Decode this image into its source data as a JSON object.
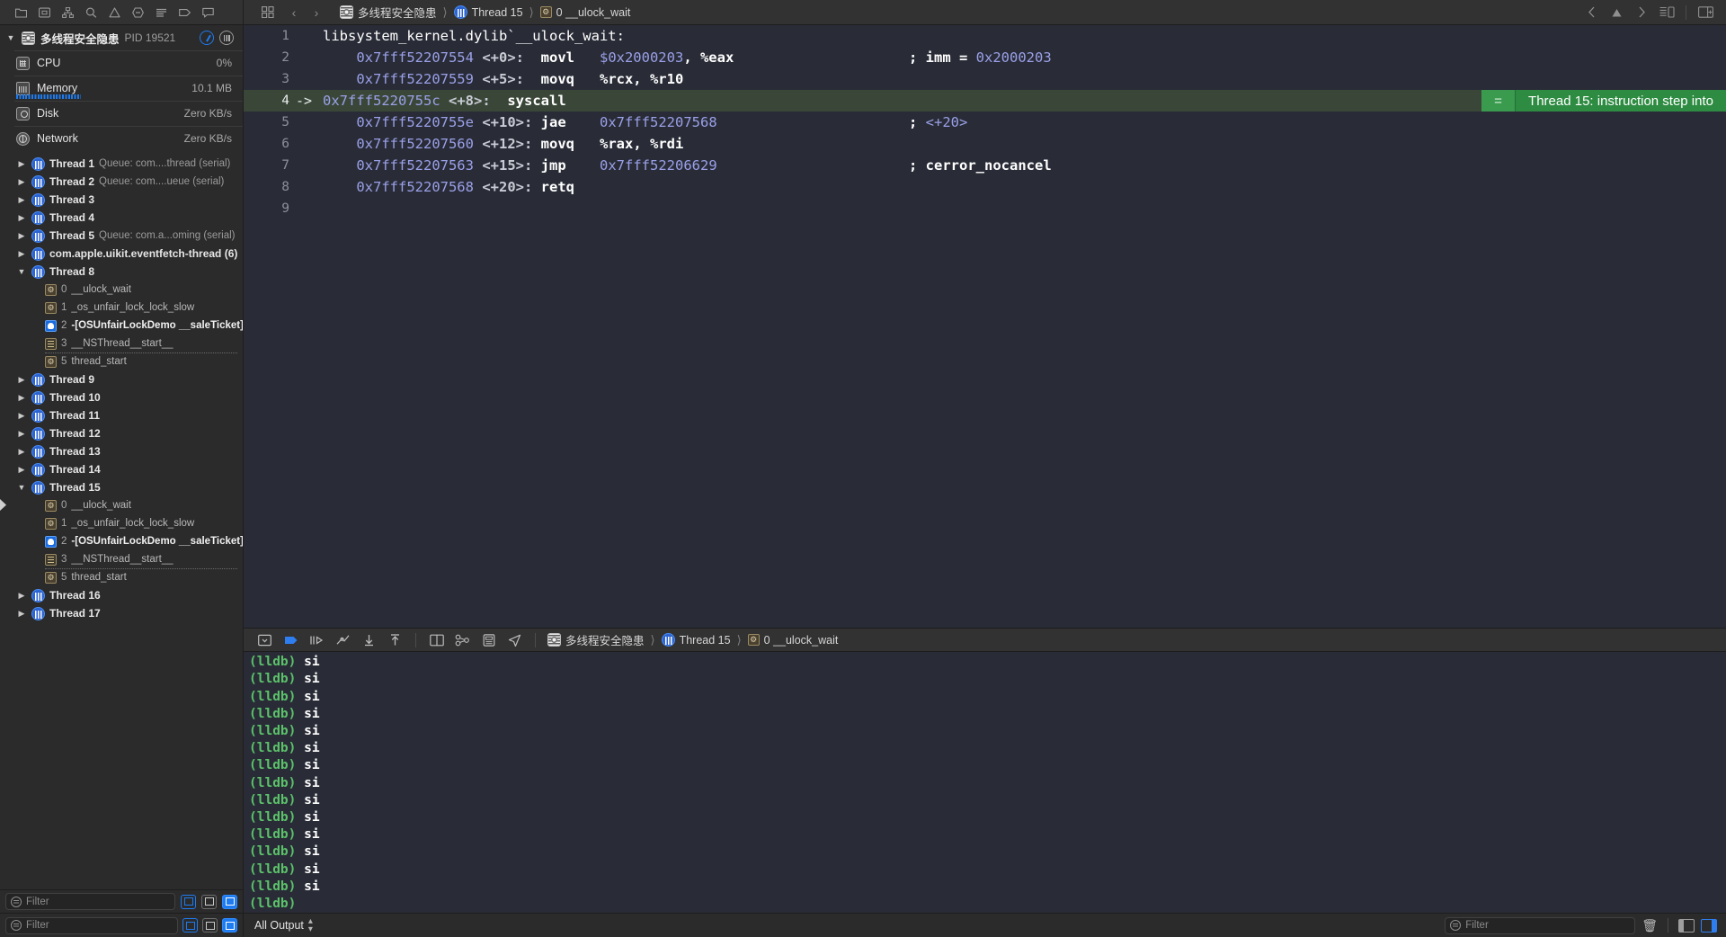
{
  "window": {
    "title": "多线程安全隐患"
  },
  "topbar": {
    "left_icons": [
      "folder-icon",
      "issue-navigator-icon",
      "hierarchy-icon",
      "search-icon",
      "warning-icon",
      "breakpoint-icon",
      "report-icon",
      "tag-icon",
      "comment-icon"
    ],
    "back_label": "‹",
    "forward_label": "›",
    "breadcrumbs": [
      {
        "icon": "app-icon",
        "label": "多线程安全隐患"
      },
      {
        "icon": "thread-icon",
        "label": "Thread 15"
      },
      {
        "icon": "frame-icon",
        "label": "0 __ulock_wait"
      }
    ],
    "right_icons": [
      "back-chevron-icon",
      "warning-triangle-icon",
      "forward-chevron-icon",
      "assistant-editor-icon",
      "inspector-panel-icon"
    ]
  },
  "sidebar": {
    "process": {
      "name": "多线程安全隐患",
      "pid": "PID 19521"
    },
    "gauges": [
      {
        "icon": "cpu-icon",
        "label": "CPU",
        "value": "0%",
        "bar": false
      },
      {
        "icon": "memory-icon",
        "label": "Memory",
        "value": "10.1 MB",
        "bar": true
      },
      {
        "icon": "disk-icon",
        "label": "Disk",
        "value": "Zero KB/s",
        "bar": false
      },
      {
        "icon": "network-icon",
        "label": "Network",
        "value": "Zero KB/s",
        "bar": false
      }
    ],
    "threads": [
      {
        "kind": "thread",
        "state": "closed",
        "label": "Thread 1",
        "queue": "Queue: com....thread (serial)"
      },
      {
        "kind": "thread",
        "state": "closed",
        "label": "Thread 2",
        "queue": "Queue: com....ueue (serial)"
      },
      {
        "kind": "thread",
        "state": "closed",
        "label": "Thread 3",
        "queue": ""
      },
      {
        "kind": "thread",
        "state": "closed",
        "label": "Thread 4",
        "queue": ""
      },
      {
        "kind": "thread",
        "state": "closed",
        "label": "Thread 5",
        "queue": "Queue: com.a...oming (serial)"
      },
      {
        "kind": "thread",
        "state": "closed",
        "label": "com.apple.uikit.eventfetch-thread (6)",
        "queue": ""
      },
      {
        "kind": "thread",
        "state": "open",
        "label": "Thread 8",
        "queue": ""
      },
      {
        "kind": "frame",
        "icon": "system-frame-icon",
        "num": "0",
        "name": "__ulock_wait",
        "user": false,
        "sep": false
      },
      {
        "kind": "frame",
        "icon": "system-frame-icon",
        "num": "1",
        "name": "_os_unfair_lock_lock_slow",
        "user": false,
        "sep": false
      },
      {
        "kind": "frame",
        "icon": "user-frame-icon",
        "num": "2",
        "name": "-[OSUnfairLockDemo __saleTicket]",
        "user": true,
        "sep": false
      },
      {
        "kind": "frame",
        "icon": "framework-frame-icon",
        "num": "3",
        "name": "__NSThread__start__",
        "user": false,
        "sep": true
      },
      {
        "kind": "frame",
        "icon": "system-frame-icon",
        "num": "5",
        "name": "thread_start",
        "user": false,
        "sep": false
      },
      {
        "kind": "thread",
        "state": "closed",
        "label": "Thread 9",
        "queue": ""
      },
      {
        "kind": "thread",
        "state": "closed",
        "label": "Thread 10",
        "queue": ""
      },
      {
        "kind": "thread",
        "state": "closed",
        "label": "Thread 11",
        "queue": ""
      },
      {
        "kind": "thread",
        "state": "closed",
        "label": "Thread 12",
        "queue": ""
      },
      {
        "kind": "thread",
        "state": "closed",
        "label": "Thread 13",
        "queue": ""
      },
      {
        "kind": "thread",
        "state": "closed",
        "label": "Thread 14",
        "queue": ""
      },
      {
        "kind": "thread",
        "state": "open",
        "label": "Thread 15",
        "queue": ""
      },
      {
        "kind": "frame",
        "icon": "system-frame-icon",
        "num": "0",
        "name": "__ulock_wait",
        "user": false,
        "sep": false,
        "current": true
      },
      {
        "kind": "frame",
        "icon": "system-frame-icon",
        "num": "1",
        "name": "_os_unfair_lock_lock_slow",
        "user": false,
        "sep": false
      },
      {
        "kind": "frame",
        "icon": "user-frame-icon",
        "num": "2",
        "name": "-[OSUnfairLockDemo __saleTicket]",
        "user": true,
        "sep": false
      },
      {
        "kind": "frame",
        "icon": "framework-frame-icon",
        "num": "3",
        "name": "__NSThread__start__",
        "user": false,
        "sep": true
      },
      {
        "kind": "frame",
        "icon": "system-frame-icon",
        "num": "5",
        "name": "thread_start",
        "user": false,
        "sep": false
      },
      {
        "kind": "thread",
        "state": "closed",
        "label": "Thread 16",
        "queue": ""
      },
      {
        "kind": "thread",
        "state": "closed",
        "label": "Thread 17",
        "queue": ""
      }
    ],
    "filter_placeholder": "Filter"
  },
  "editor": {
    "lines": [
      {
        "n": "1",
        "arrow": "",
        "current": false,
        "tokens": [
          {
            "t": "libsystem_kernel.dylib`__ulock_wait:",
            "c": "src-title"
          }
        ]
      },
      {
        "n": "2",
        "arrow": "",
        "current": false,
        "tokens": [
          {
            "t": "    ",
            "c": "oper"
          },
          {
            "t": "0x7fff52207554",
            "c": "addr"
          },
          {
            "t": " ",
            "c": "oper"
          },
          {
            "t": "<+0>",
            "c": "off"
          },
          {
            "t": ":  ",
            "c": "off"
          },
          {
            "t": "movl",
            "c": "mnem"
          },
          {
            "t": "   ",
            "c": "mnem"
          },
          {
            "t": "$0x2000203",
            "c": "num"
          },
          {
            "t": ", %eax",
            "c": "oper"
          }
        ],
        "comment": [
          {
            "t": "; ",
            "c": "cmt"
          },
          {
            "t": "imm = ",
            "c": "cmt"
          },
          {
            "t": "0x2000203",
            "c": "cmtnum"
          }
        ]
      },
      {
        "n": "3",
        "arrow": "",
        "current": false,
        "tokens": [
          {
            "t": "    ",
            "c": "oper"
          },
          {
            "t": "0x7fff52207559",
            "c": "addr"
          },
          {
            "t": " ",
            "c": "oper"
          },
          {
            "t": "<+5>",
            "c": "off"
          },
          {
            "t": ":  ",
            "c": "off"
          },
          {
            "t": "movq",
            "c": "mnem"
          },
          {
            "t": "   ",
            "c": "mnem"
          },
          {
            "t": "%rcx, %r10",
            "c": "oper"
          }
        ],
        "comment": []
      },
      {
        "n": "4",
        "arrow": "->",
        "current": true,
        "tokens": [
          {
            "t": "0x7fff5220755c",
            "c": "addr"
          },
          {
            "t": " ",
            "c": "oper"
          },
          {
            "t": "<+8>",
            "c": "off"
          },
          {
            "t": ":  ",
            "c": "off"
          },
          {
            "t": "syscall",
            "c": "mnem"
          }
        ],
        "comment": []
      },
      {
        "n": "5",
        "arrow": "",
        "current": false,
        "tokens": [
          {
            "t": "    ",
            "c": "oper"
          },
          {
            "t": "0x7fff5220755e",
            "c": "addr"
          },
          {
            "t": " ",
            "c": "oper"
          },
          {
            "t": "<+10>",
            "c": "off"
          },
          {
            "t": ": ",
            "c": "off"
          },
          {
            "t": "jae",
            "c": "mnem"
          },
          {
            "t": "    ",
            "c": "mnem"
          },
          {
            "t": "0x7fff52207568",
            "c": "num"
          }
        ],
        "comment": [
          {
            "t": "; ",
            "c": "cmt"
          },
          {
            "t": "<+20>",
            "c": "cmtnum"
          }
        ]
      },
      {
        "n": "6",
        "arrow": "",
        "current": false,
        "tokens": [
          {
            "t": "    ",
            "c": "oper"
          },
          {
            "t": "0x7fff52207560",
            "c": "addr"
          },
          {
            "t": " ",
            "c": "oper"
          },
          {
            "t": "<+12>",
            "c": "off"
          },
          {
            "t": ": ",
            "c": "off"
          },
          {
            "t": "movq",
            "c": "mnem"
          },
          {
            "t": "   ",
            "c": "mnem"
          },
          {
            "t": "%rax, %rdi",
            "c": "oper"
          }
        ],
        "comment": []
      },
      {
        "n": "7",
        "arrow": "",
        "current": false,
        "tokens": [
          {
            "t": "    ",
            "c": "oper"
          },
          {
            "t": "0x7fff52207563",
            "c": "addr"
          },
          {
            "t": " ",
            "c": "oper"
          },
          {
            "t": "<+15>",
            "c": "off"
          },
          {
            "t": ": ",
            "c": "off"
          },
          {
            "t": "jmp",
            "c": "mnem"
          },
          {
            "t": "    ",
            "c": "mnem"
          },
          {
            "t": "0x7fff52206629",
            "c": "num"
          }
        ],
        "comment": [
          {
            "t": "; ",
            "c": "cmt"
          },
          {
            "t": "cerror_nocancel",
            "c": "cmt"
          }
        ]
      },
      {
        "n": "8",
        "arrow": "",
        "current": false,
        "tokens": [
          {
            "t": "    ",
            "c": "oper"
          },
          {
            "t": "0x7fff52207568",
            "c": "addr"
          },
          {
            "t": " ",
            "c": "oper"
          },
          {
            "t": "<+20>",
            "c": "off"
          },
          {
            "t": ": ",
            "c": "off"
          },
          {
            "t": "retq",
            "c": "mnem"
          }
        ],
        "comment": []
      },
      {
        "n": "9",
        "arrow": "",
        "current": false,
        "tokens": [],
        "comment": []
      }
    ],
    "step_banner": {
      "eq": "=",
      "text": "Thread 15: instruction step into"
    }
  },
  "debugbar": {
    "icons": [
      "hide-debug-area-icon",
      "continue-icon",
      "step-over-icon",
      "step-into-icon",
      "step-out-icon",
      "step-out-of-icon",
      "view-hierarchy-icon",
      "memory-graph-icon",
      "environment-overrides-icon",
      "location-icon"
    ],
    "breadcrumbs": [
      {
        "icon": "app-icon",
        "label": "多线程安全隐患"
      },
      {
        "icon": "thread-icon",
        "label": "Thread 15"
      },
      {
        "icon": "frame-icon",
        "label": "0 __ulock_wait"
      }
    ]
  },
  "console": {
    "lines": [
      {
        "prompt": "(lldb)",
        "cmd": "si"
      },
      {
        "prompt": "(lldb)",
        "cmd": "si"
      },
      {
        "prompt": "(lldb)",
        "cmd": "si"
      },
      {
        "prompt": "(lldb)",
        "cmd": "si"
      },
      {
        "prompt": "(lldb)",
        "cmd": "si"
      },
      {
        "prompt": "(lldb)",
        "cmd": "si"
      },
      {
        "prompt": "(lldb)",
        "cmd": "si"
      },
      {
        "prompt": "(lldb)",
        "cmd": "si"
      },
      {
        "prompt": "(lldb)",
        "cmd": "si"
      },
      {
        "prompt": "(lldb)",
        "cmd": "si"
      },
      {
        "prompt": "(lldb)",
        "cmd": "si"
      },
      {
        "prompt": "(lldb)",
        "cmd": "si"
      },
      {
        "prompt": "(lldb)",
        "cmd": "si"
      },
      {
        "prompt": "(lldb)",
        "cmd": "si"
      },
      {
        "prompt": "(lldb)",
        "cmd": "si"
      },
      {
        "prompt": "(lldb)",
        "cmd": ""
      }
    ]
  },
  "bottombar": {
    "left_filter_placeholder": "Filter",
    "output_scope": "All Output",
    "right_filter_placeholder": "Filter"
  },
  "colors": {
    "accent_blue": "#1e7bf0",
    "step_green": "#2e8b42",
    "current_line": "#3a4738",
    "editor_bg": "#292c37",
    "chrome_bg": "#2b2b2b"
  }
}
